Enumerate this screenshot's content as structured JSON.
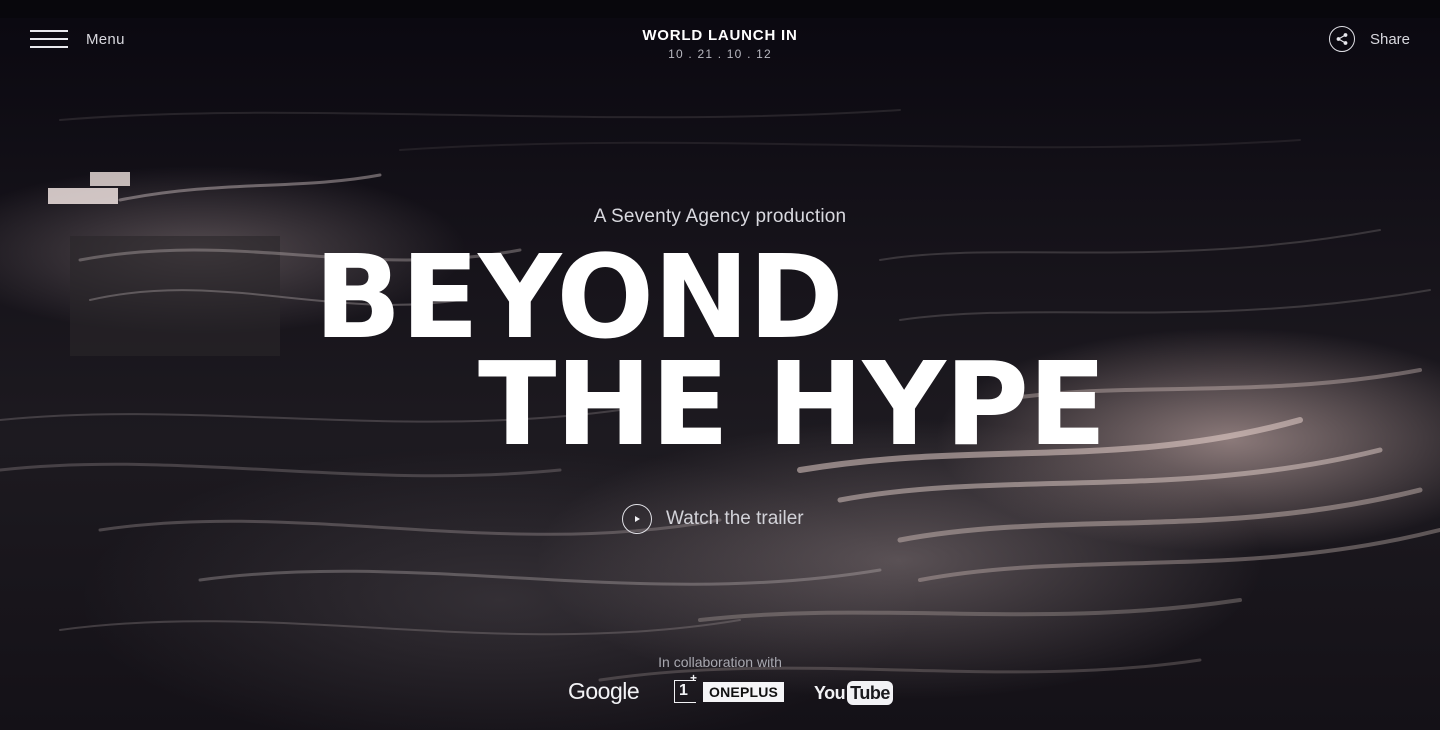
{
  "header": {
    "menu_label": "Menu",
    "launch_title": "WORLD LAUNCH IN",
    "launch_countdown": "10 . 21 . 10 . 12",
    "share_label": "Share"
  },
  "hero": {
    "production": "A Seventy Agency production",
    "headline_line1": "BEYOND",
    "headline_line2": "THE HYPE",
    "trailer_label": "Watch the trailer"
  },
  "footer": {
    "collab_label": "In collaboration with",
    "partners": {
      "google": "Google",
      "oneplus_mark": "1",
      "oneplus_name": "ONEPLUS",
      "youtube_you": "You",
      "youtube_tube": "Tube"
    }
  },
  "colors": {
    "background": "#0c0a10",
    "text": "#ffffff",
    "muted_text": "#d8d8de",
    "highlight_pink": "#e6c8c3"
  },
  "icons": {
    "menu": "hamburger-icon",
    "share": "share-icon",
    "play": "play-icon"
  }
}
